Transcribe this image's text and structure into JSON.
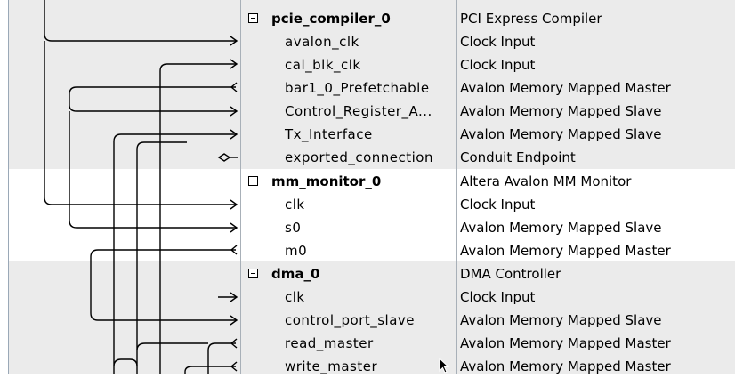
{
  "components": [
    {
      "name": "pcie_compiler_0",
      "description": "PCI Express Compiler",
      "interfaces": [
        {
          "name": "avalon_clk",
          "type": "Clock Input"
        },
        {
          "name": "cal_blk_clk",
          "type": "Clock Input"
        },
        {
          "name": "bar1_0_Prefetchable",
          "type": "Avalon Memory Mapped Master"
        },
        {
          "name": "Control_Register_A...",
          "type": "Avalon Memory Mapped Slave"
        },
        {
          "name": "Tx_Interface",
          "type": "Avalon Memory Mapped Slave"
        },
        {
          "name": "exported_connection",
          "type": "Conduit Endpoint"
        }
      ]
    },
    {
      "name": "mm_monitor_0",
      "description": "Altera Avalon MM Monitor",
      "interfaces": [
        {
          "name": "clk",
          "type": "Clock Input"
        },
        {
          "name": "s0",
          "type": "Avalon Memory Mapped Slave"
        },
        {
          "name": "m0",
          "type": "Avalon Memory Mapped Master"
        }
      ]
    },
    {
      "name": "dma_0",
      "description": "DMA Controller",
      "interfaces": [
        {
          "name": "clk",
          "type": "Clock Input"
        },
        {
          "name": "control_port_slave",
          "type": "Avalon Memory Mapped Slave"
        },
        {
          "name": "read_master",
          "type": "Avalon Memory Mapped Master"
        },
        {
          "name": "write_master",
          "type": "Avalon Memory Mapped Master"
        }
      ]
    }
  ],
  "colors": {
    "shaded_row": "#ebebeb",
    "white_row": "#ffffff",
    "wire": "#000000",
    "separator": "#a8b0b8"
  }
}
